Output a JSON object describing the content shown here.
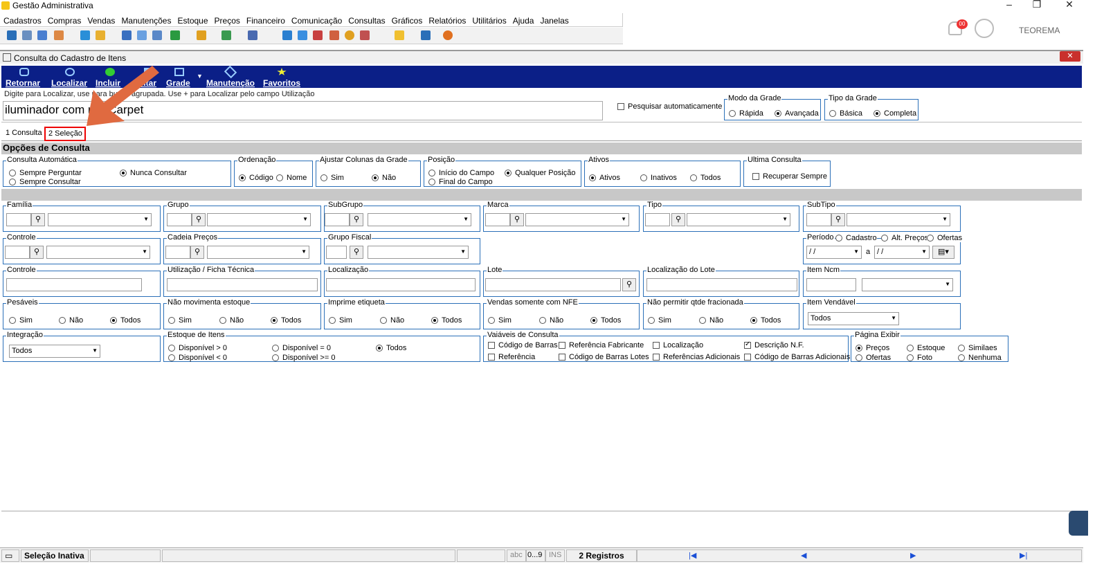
{
  "app": {
    "title": "Gestão Administrativa",
    "user": "TEOREMA",
    "notification_count": "00"
  },
  "menu": [
    "Cadastros",
    "Compras",
    "Vendas",
    "Manutenções",
    "Estoque",
    "Preços",
    "Financeiro",
    "Comunicação",
    "Consultas",
    "Gráficos",
    "Relatórios",
    "Utilitários",
    "Ajuda",
    "Janelas"
  ],
  "window": {
    "title": "Consulta do Cadastro de Itens",
    "close": "✕"
  },
  "actions": {
    "retornar": "Retornar",
    "localizar": "Localizar",
    "incluir": "Incluir",
    "editar": "Editar",
    "grade": "Grade",
    "manutencao": "Manutenção",
    "favoritos": "Favoritos"
  },
  "search": {
    "hint": "Digite para Localizar, use  para busca agrupada. Use + para Localizar pelo campo Utilização",
    "value": "iluminador com red Carpet",
    "auto": "Pesquisar automaticamente"
  },
  "modo_grade": {
    "legend": "Modo da Grade",
    "opt1": "Rápida",
    "opt2": "Avançada"
  },
  "tipo_grade": {
    "legend": "Tipo da Grade",
    "opt1": "Básica",
    "opt2": "Completa"
  },
  "tabs": {
    "tab1": "1 Consulta",
    "tab2": "2 Seleção"
  },
  "opcoes": {
    "header": "Opções de Consulta"
  },
  "consulta_auto": {
    "legend": "Consulta Automática",
    "o1": "Sempre Perguntar",
    "o2": "Sempre Consultar",
    "o3": "Nunca Consultar"
  },
  "ordenacao": {
    "legend": "Ordenação",
    "o1": "Código",
    "o2": "Nome"
  },
  "ajustar": {
    "legend": "Ajustar Colunas da Grade",
    "o1": "Sim",
    "o2": "Não"
  },
  "posicao": {
    "legend": "Posição",
    "o1": "Início do Campo",
    "o2": "Final do Campo",
    "o3": "Qualquer Posição"
  },
  "ativos": {
    "legend": "Ativos",
    "o1": "Ativos",
    "o2": "Inativos",
    "o3": "Todos"
  },
  "ultima": {
    "legend": "Ultima Consulta",
    "o1": "Recuperar Sempre"
  },
  "row1": {
    "familia": "Família",
    "grupo": "Grupo",
    "subgrupo": "SubGrupo",
    "marca": "Marca",
    "tipo": "Tipo",
    "subtipo": "SubTipo"
  },
  "row2": {
    "controle": "Controle",
    "cadeia": "Cadeia Preços",
    "grupo_fiscal": "Grupo Fiscal",
    "periodo": "Período",
    "cadastro": "Cadastro",
    "alt_precos": "Alt. Preços",
    "ofertas": "Ofertas",
    "date1": "/ /",
    "date2": "/ /",
    "a": "a"
  },
  "row3": {
    "controle": "Controle",
    "utilizacao": "Utilização / Ficha Técnica",
    "localizacao": "Localização",
    "lote": "Lote",
    "loc_lote": "Localização do Lote",
    "item_ncm": "Item Ncm"
  },
  "row4": {
    "pesaveis": "Pesáveis",
    "nao_mov": "Não movimenta estoque",
    "imprime": "Imprime etiqueta",
    "vendas_nfe": "Vendas somente com NFE",
    "nao_permitir": "Não permitir qtde fracionada",
    "item_vendavel": "Item Vendável",
    "sim": "Sim",
    "nao": "Não",
    "todos": "Todos",
    "vendavel_value": "Todos"
  },
  "integracao": {
    "legend": "Integração",
    "value": "Todos"
  },
  "estoque": {
    "legend": "Estoque de Itens",
    "o1": "Disponível > 0",
    "o2": "Disponível < 0",
    "o3": "Disponível = 0",
    "o4": "Disponível >= 0",
    "o5": "Todos"
  },
  "variaveis": {
    "legend": "Vaiáveis de Consulta",
    "c1": "Código de Barras",
    "c2": "Referência",
    "c3": "Referência Fabricante",
    "c4": "Código de Barras Lotes",
    "c5": "Localização",
    "c6": "Referências Adicionais",
    "c7": "Descrição N.F.",
    "c8": "Código de Barras Adicionais"
  },
  "pagina": {
    "legend": "Página Exibir",
    "o1": "Preços",
    "o2": "Ofertas",
    "o3": "Estoque",
    "o4": "Foto",
    "o5": "Similaes",
    "o6": "Nenhuma"
  },
  "status": {
    "selecao": "Seleção Inativa",
    "abc": "abc",
    "num": "0...9",
    "ins": "INS",
    "registros": "2 Registros"
  }
}
